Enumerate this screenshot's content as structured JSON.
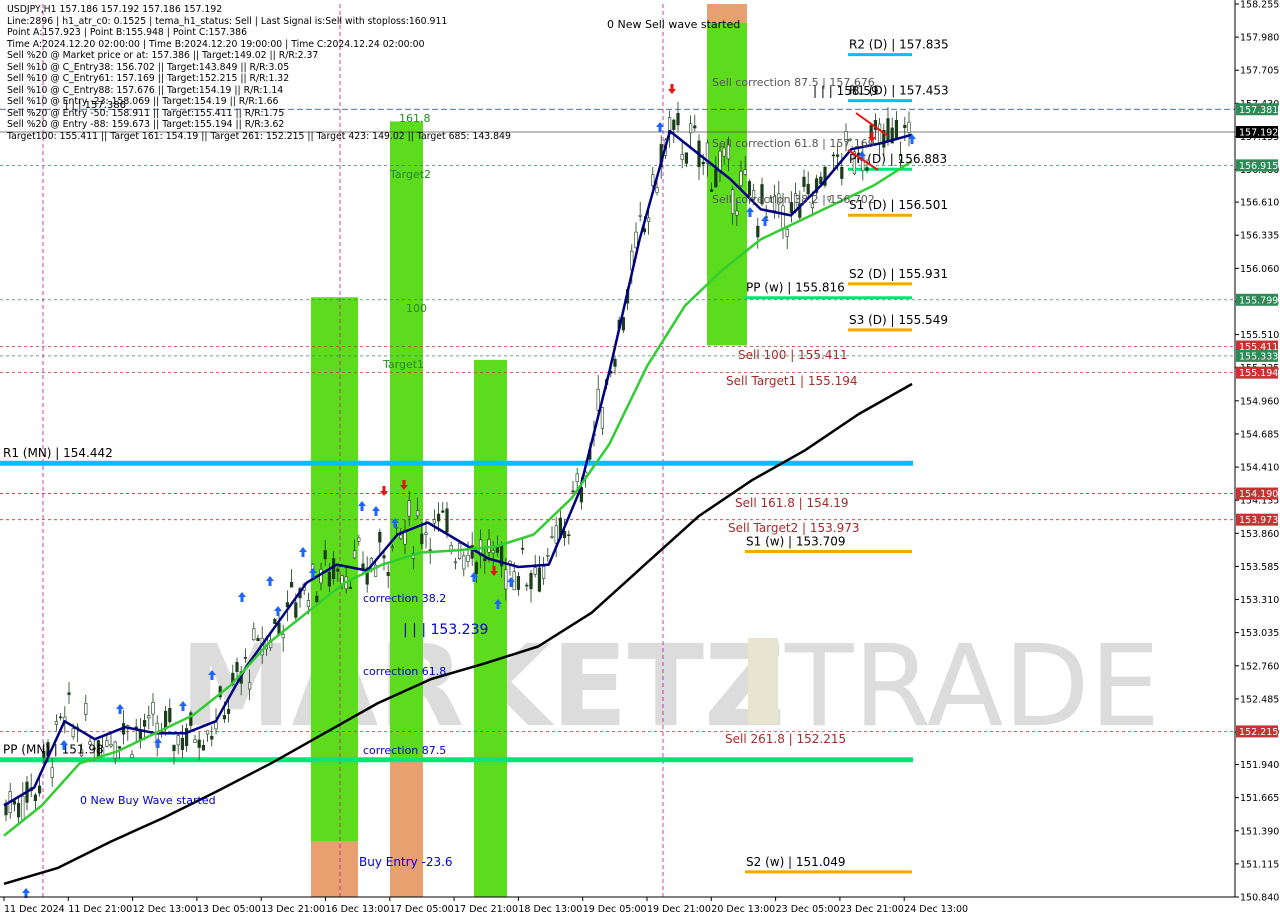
{
  "chart_info": {
    "header_lines": [
      "USDJPY,H1  157.186 157.192 157.186 157.192",
      "Line:2896  | h1_atr_c0: 0.1525  | tema_h1_status: Sell  | Last Signal is:Sell with stoploss:160.911",
      "Point A:157.923  | Point B:155.948  | Point C:157.386",
      "Time A:2024.12.20 02:00:00  | Time B:2024.12.20 19:00:00  | Time C:2024.12.24 02:00:00",
      "Sell %20 @ Market price or at: 157.386  || Target:149.02  || R/R:2.37",
      "Sell %10 @ C_Entry38: 156.702  || Target:143.849  || R/R:3.05",
      "Sell %10 @ C_Entry61: 157.169  || Target:152.215  || R/R:1.32",
      "Sell %10 @ C_Entry88: 157.676  || Target:154.19  || R/R:1.14",
      "Sell %10 @ Entry -23: 158.069  || Target:154.19  || R/R:1.66",
      "Sell %20 @ Entry -50: 158.911  || Target:155.411  || R/R:1.75",
      "Sell %20 @ Entry -88: 159.673  || Target:155.194  || R/R:3.62",
      "Target100: 155.411  || Target 161: 154.19  || Target 261: 152.215  || Target 423: 149.02  || Target 685: 143.849"
    ]
  },
  "watermark": {
    "part1": "MARKETZ",
    "part2": "TRADE"
  },
  "chart_data": {
    "type": "line",
    "symbol": "USDJPY",
    "timeframe": "H1",
    "ylim": [
      150.84,
      158.255
    ],
    "y_ticks": [
      "158.255",
      "157.980",
      "157.705",
      "157.430",
      "157.155",
      "156.880",
      "156.610",
      "156.335",
      "156.060",
      "155.785",
      "155.510",
      "155.235",
      "154.960",
      "154.685",
      "154.410",
      "154.135",
      "153.860",
      "153.585",
      "153.310",
      "153.035",
      "152.760",
      "152.485",
      "152.210",
      "151.940",
      "151.665",
      "151.390",
      "151.115",
      "150.840"
    ],
    "x_ticks": [
      "11 Dec 2024",
      "11 Dec 21:00",
      "12 Dec 13:00",
      "13 Dec 05:00",
      "13 Dec 21:00",
      "16 Dec 13:00",
      "17 Dec 05:00",
      "17 Dec 21:00",
      "18 Dec 13:00",
      "19 Dec 05:00",
      "19 Dec 21:00",
      "20 Dec 13:00",
      "23 Dec 05:00",
      "23 Dec 21:00",
      "24 Dec 13:00"
    ],
    "series": [
      {
        "name": "",
        "color": "#000080",
        "values": [
          151.6,
          151.75,
          152.3,
          152.15,
          152.25,
          152.2,
          152.2,
          152.3,
          152.75,
          153.1,
          153.45,
          153.6,
          153.55,
          153.85,
          153.95,
          153.8,
          153.65,
          153.58,
          153.6,
          154.2,
          155.2,
          156.3,
          157.2,
          157.0,
          156.8,
          156.55,
          156.5,
          156.75,
          157.05,
          157.1,
          157.17
        ]
      },
      {
        "name": "",
        "color": "#32cd32",
        "values": [
          151.35,
          151.6,
          151.95,
          152.05,
          152.2,
          152.35,
          152.6,
          152.95,
          153.2,
          153.45,
          153.6,
          153.7,
          153.72,
          153.75,
          153.85,
          154.15,
          154.6,
          155.25,
          155.75,
          156.05,
          156.3,
          156.45,
          156.6,
          156.75,
          156.95
        ]
      },
      {
        "name": "",
        "color": "#000000",
        "values": [
          150.95,
          151.08,
          151.3,
          151.5,
          151.72,
          151.95,
          152.2,
          152.45,
          152.65,
          152.78,
          152.92,
          153.2,
          153.6,
          154.0,
          154.3,
          154.55,
          154.85,
          155.1
        ]
      }
    ],
    "price_labels": [
      {
        "text": "157.381",
        "value": 157.381,
        "bg": "#2e8b57"
      },
      {
        "text": "157.192",
        "value": 157.192,
        "bg": "#000000"
      },
      {
        "text": "156.915",
        "value": 156.915,
        "bg": "#2e8b57"
      },
      {
        "text": "155.799",
        "value": 155.799,
        "bg": "#2e8b57"
      },
      {
        "text": "155.411",
        "value": 155.411,
        "bg": "#c83232"
      },
      {
        "text": "155.333",
        "value": 155.333,
        "bg": "#2e8b57"
      },
      {
        "text": "155.194",
        "value": 155.194,
        "bg": "#c83232"
      },
      {
        "text": "154.190",
        "value": 154.19,
        "bg": "#c83232"
      },
      {
        "text": "153.973",
        "value": 153.973,
        "bg": "#c83232"
      },
      {
        "text": "152.215",
        "value": 152.215,
        "bg": "#c83232"
      }
    ],
    "level_lines": [
      {
        "text": "R2 (D) | 157.835",
        "value": 157.835,
        "color": "#00bfff"
      },
      {
        "text": "R1 (D) | 157.453",
        "value": 157.453,
        "color": "#00bfff"
      },
      {
        "text": "PP (D) | 156.883",
        "value": 156.883,
        "color": "#00e676"
      },
      {
        "text": "S1 (D) | 156.501",
        "value": 156.501,
        "color": "#ffa500"
      },
      {
        "text": "S2 (D) | 155.931",
        "value": 155.931,
        "color": "#ffa500"
      },
      {
        "text": "PP (w) | 155.816",
        "value": 155.816,
        "color": "#00e676"
      },
      {
        "text": "S3 (D) | 155.549",
        "value": 155.549,
        "color": "#ffa500"
      },
      {
        "text": "S1 (w) | 153.709",
        "value": 153.709,
        "color": "#ffa500"
      },
      {
        "text": "S2 (w) | 151.049",
        "value": 151.049,
        "color": "#ffa500"
      },
      {
        "text": "R1 (MN) | 154.442",
        "value": 154.442,
        "color": "#00bfff"
      },
      {
        "text": "PP (MN) | 151.98",
        "value": 151.98,
        "color": "#00e676"
      }
    ],
    "annotations": [
      {
        "text": "0 New Sell wave started",
        "color": "#000000"
      },
      {
        "text": "Sell correction 87.5 | 157.676",
        "color": "#555555"
      },
      {
        "text": "Sell correction 61.8 | 157.169",
        "color": "#555555"
      },
      {
        "text": "Sell correction 38.2 | 156.702",
        "color": "#555555"
      },
      {
        "text": "Sell 100 | 155.411",
        "color": "#a52a2a"
      },
      {
        "text": "Sell Target1 | 155.194",
        "color": "#a52a2a"
      },
      {
        "text": "Sell 161.8 | 154.19",
        "color": "#a52a2a"
      },
      {
        "text": "Sell Target2 | 153.973",
        "color": "#a52a2a"
      },
      {
        "text": "Sell  261.8 | 152.215",
        "color": "#a52a2a"
      },
      {
        "text": "161.8",
        "color": "#228b22"
      },
      {
        "text": "Target2",
        "color": "#228b22"
      },
      {
        "text": "100",
        "color": "#228b22"
      },
      {
        "text": "Target1",
        "color": "#228b22"
      },
      {
        "text": "correction 38.2",
        "color": "#0000cd"
      },
      {
        "text": "correction 61.8",
        "color": "#0000cd"
      },
      {
        "text": "correction 87.5",
        "color": "#0000cd"
      },
      {
        "text": "| | | 153.239",
        "color": "#0000cd"
      },
      {
        "text": "0 New Buy Wave started",
        "color": "#0000cd"
      },
      {
        "text": "Buy Entry -23.6",
        "color": "#0000cd"
      },
      {
        "text": "| | | 157.386",
        "color": "#000000"
      },
      {
        "text": "| | | 158.59",
        "color": "#000000"
      }
    ]
  }
}
